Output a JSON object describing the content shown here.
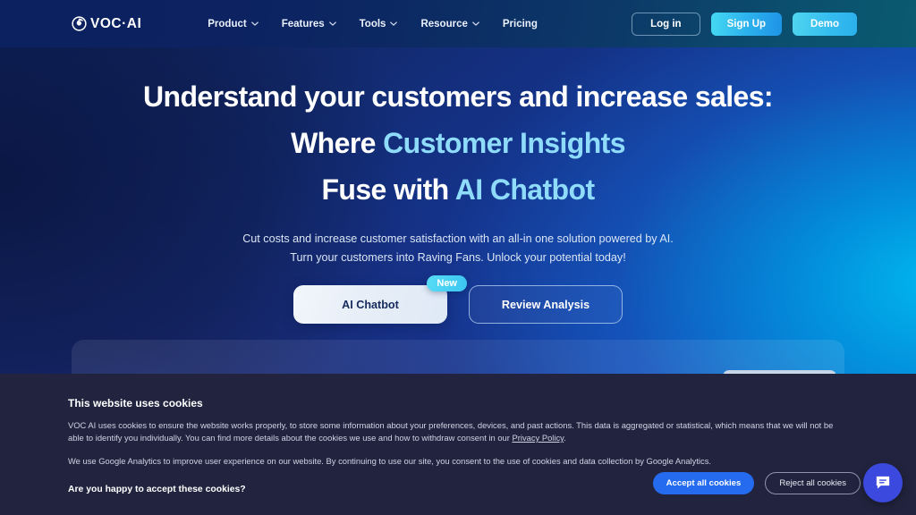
{
  "header": {
    "logo_text": "VOC·AI",
    "logo_icon": "voc-ai-swirl-logo-icon",
    "nav": [
      {
        "label": "Product",
        "has_dropdown": true
      },
      {
        "label": "Features",
        "has_dropdown": true
      },
      {
        "label": "Tools",
        "has_dropdown": true
      },
      {
        "label": "Resource",
        "has_dropdown": true
      },
      {
        "label": "Pricing",
        "has_dropdown": false
      }
    ],
    "login_label": "Log in",
    "signup_label": "Sign Up",
    "demo_label": "Demo"
  },
  "hero": {
    "headline_line1": "Understand your customers and increase sales:",
    "headline_line2_plain": "Where ",
    "headline_line2_highlight": "Customer Insights",
    "headline_line3_plain": "Fuse with ",
    "headline_line3_highlight": "AI Chatbot",
    "subtitle_line1": "Cut costs and increase customer satisfaction with an all-in one solution powered by AI.",
    "subtitle_line2": "Turn your customers into Raving Fans. Unlock your potential today!",
    "cta_primary_label": "AI Chatbot",
    "cta_primary_badge": "New",
    "cta_secondary_label": "Review Analysis"
  },
  "cookie_banner": {
    "title": "This website uses cookies",
    "body_part1": "VOC AI uses cookies to ensure the website works properly, to store some information about your preferences, devices, and past actions. This data is aggregated or statistical, which means that we will not be able to identify you individually. You can find more details about the cookies we use and how to withdraw consent in our ",
    "privacy_link": "Privacy Policy",
    "body_part2": ".",
    "body2": "We use Google Analytics to improve user experience on our website. By continuing to use our site, you consent to the use of cookies and data collection by Google Analytics.",
    "question": "Are you happy to accept these cookies?",
    "accept_label": "Accept all cookies",
    "reject_label": "Reject all cookies"
  },
  "chat_widget": {
    "icon": "chat-bubble-icon"
  },
  "colors": {
    "accent_cyan": "#8fdcfa",
    "signup_gradient_start": "#45d9f2",
    "signup_gradient_end": "#1e93e6",
    "badge_gradient_start": "#58dcf5",
    "badge_gradient_end": "#3bc6f1",
    "cookie_bg": "#22243f",
    "accept_button": "#246bf0",
    "chat_fab": "#3b49df",
    "hero_bg_dark": "#10235e",
    "hero_bg_light": "#1b8fd8"
  }
}
